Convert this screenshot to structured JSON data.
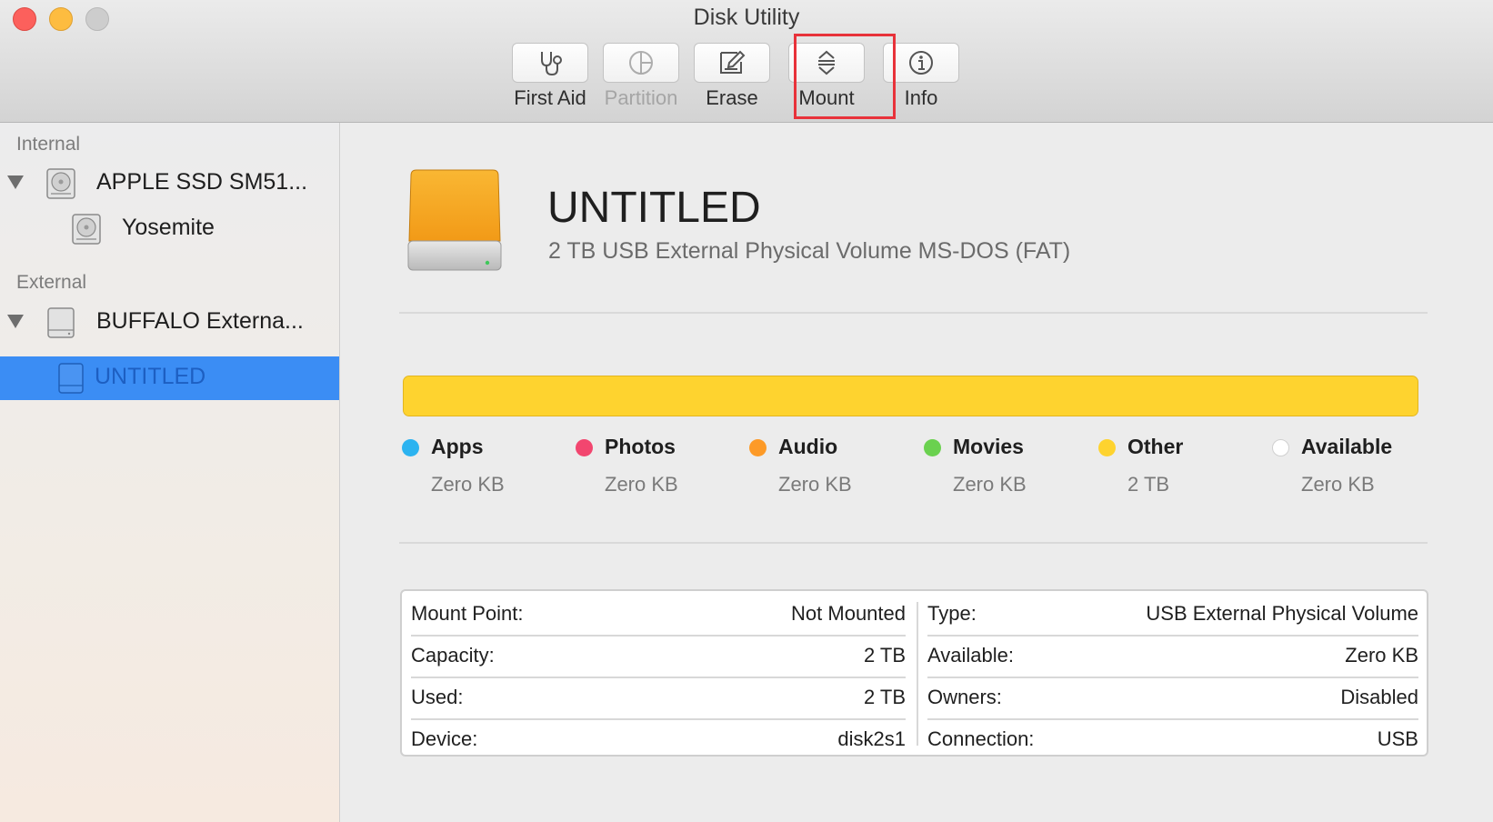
{
  "window": {
    "title": "Disk Utility"
  },
  "toolbar": {
    "first_aid": "First Aid",
    "partition": "Partition",
    "erase": "Erase",
    "mount": "Mount",
    "info": "Info"
  },
  "sidebar": {
    "internal_header": "Internal",
    "external_header": "External",
    "items": [
      {
        "label": "APPLE SSD SM51..."
      },
      {
        "label": "Yosemite"
      },
      {
        "label": "BUFFALO Externa..."
      },
      {
        "label": "UNTITLED"
      }
    ]
  },
  "volume": {
    "name": "UNTITLED",
    "description": "2 TB USB External Physical Volume MS-DOS (FAT)"
  },
  "usage": {
    "bar_color": "#fed32f",
    "other_fraction": 1.0,
    "categories": [
      {
        "name": "Apps",
        "value": "Zero KB",
        "color": "#2cb3f0"
      },
      {
        "name": "Photos",
        "value": "Zero KB",
        "color": "#f2466f"
      },
      {
        "name": "Audio",
        "value": "Zero KB",
        "color": "#fd9a27"
      },
      {
        "name": "Movies",
        "value": "Zero KB",
        "color": "#6ad14f"
      },
      {
        "name": "Other",
        "value": "2 TB",
        "color": "#fed32f"
      },
      {
        "name": "Available",
        "value": "Zero KB",
        "color": "#ffffff"
      }
    ]
  },
  "info": {
    "left": [
      {
        "key": "Mount Point:",
        "value": "Not Mounted"
      },
      {
        "key": "Capacity:",
        "value": "2 TB"
      },
      {
        "key": "Used:",
        "value": "2 TB"
      },
      {
        "key": "Device:",
        "value": "disk2s1"
      }
    ],
    "right": [
      {
        "key": "Type:",
        "value": "USB External Physical Volume"
      },
      {
        "key": "Available:",
        "value": "Zero KB"
      },
      {
        "key": "Owners:",
        "value": "Disabled"
      },
      {
        "key": "Connection:",
        "value": "USB"
      }
    ]
  }
}
